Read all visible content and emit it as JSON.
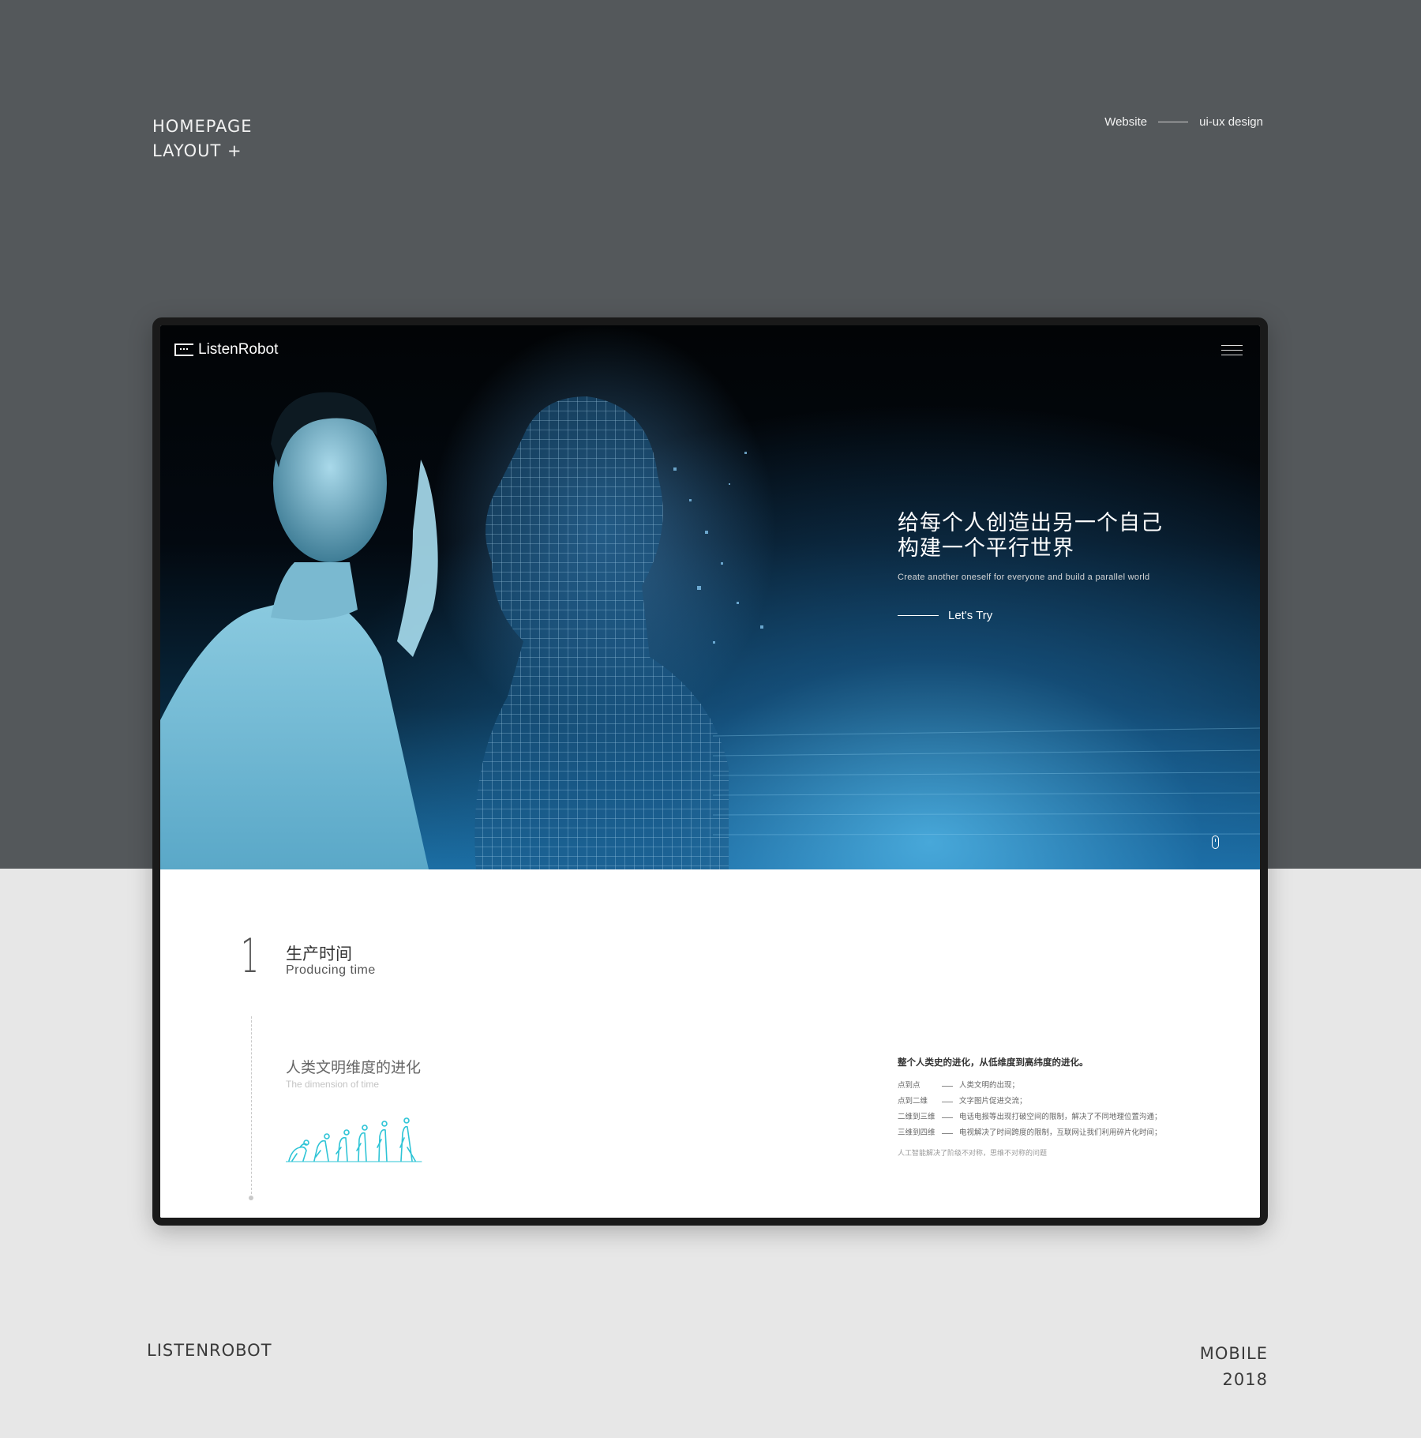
{
  "presentation": {
    "title_line1": "HOMEPAGE",
    "title_line2": "LAYOUT +",
    "meta_left": "Website",
    "meta_right": "ui-ux design",
    "footer_left": "LISTENROBOT",
    "footer_right_line1": "MOBILE",
    "footer_right_line2": "2018"
  },
  "site": {
    "logo_text": "ListenRobot",
    "menu_icon": "hamburger-menu-icon",
    "hero": {
      "title_line1": "给每个人创造出另一个自己",
      "title_line2": "构建一个平行世界",
      "subtitle": "Create another oneself for everyone and build a parallel world",
      "cta_label": "Let's Try",
      "scroll_icon": "mouse-scroll-icon"
    },
    "section": {
      "number": "1",
      "title": "生产时间",
      "title_en": "Producing time",
      "sub_title": "人类文明维度的进化",
      "sub_title_en": "The dimension of time",
      "evolution_icon": "human-evolution-icon",
      "text_heading": "整个人类史的进化，从低维度到高纬度的进化。",
      "rows": [
        {
          "key": "点到点",
          "value": "人类文明的出现；"
        },
        {
          "key": "点到二维",
          "value": "文字图片促进交流；"
        },
        {
          "key": "二维到三维",
          "value": "电话电报等出现打破空间的限制，解决了不同地理位置沟通；"
        },
        {
          "key": "三维到四维",
          "value": "电视解决了时间跨度的限制，互联网让我们利用碎片化时间；"
        }
      ],
      "text_footer": "人工智能解决了阶级不对称，思维不对称的问题"
    }
  },
  "colors": {
    "top_band": "#54585b",
    "bottom_band": "#e7e7e7",
    "accent_cyan": "#2ec4d6"
  }
}
